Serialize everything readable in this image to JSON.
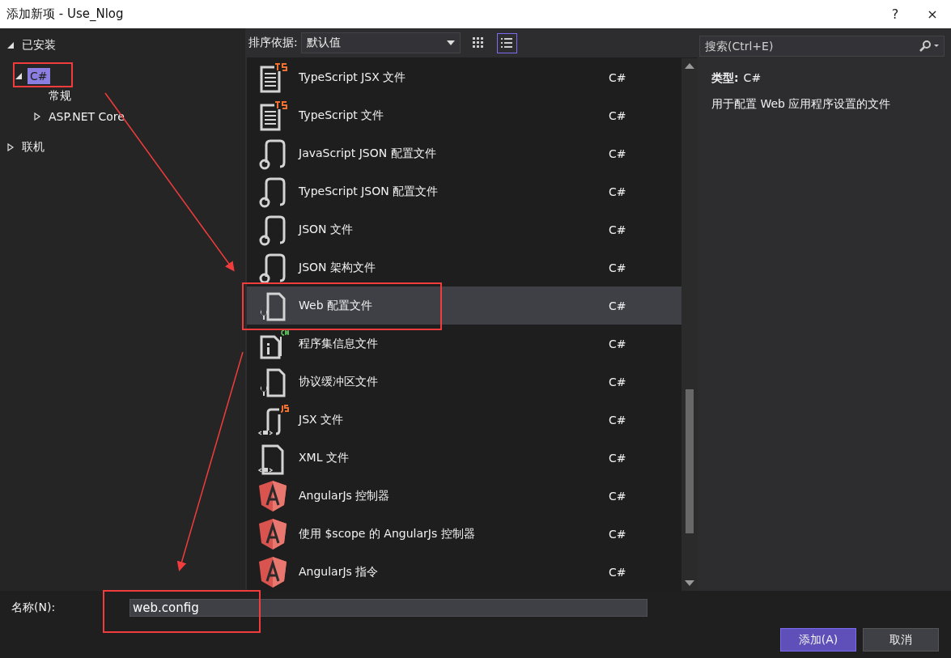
{
  "window": {
    "title": "添加新项 - Use_Nlog",
    "buttons": [
      "?",
      "×"
    ]
  },
  "tree": [
    {
      "label": "已安装",
      "expanded": true,
      "selected": false,
      "children": [
        {
          "label": "C#",
          "expanded": true,
          "selected": true,
          "children": [
            {
              "label": "常规",
              "selected": false
            },
            {
              "label": "ASP.NET Core",
              "expanded": false,
              "selected": false
            }
          ]
        }
      ]
    },
    {
      "label": "联机",
      "expanded": false,
      "selected": false
    }
  ],
  "toolbar": {
    "sort_label": "排序依据:",
    "sort_value": "默认值",
    "views": [
      {
        "kind": "grid",
        "selected": false
      },
      {
        "kind": "list",
        "selected": true
      }
    ]
  },
  "templates": [
    {
      "name": "TypeScript JSX 文件",
      "type": "C#",
      "kind": "ts",
      "selected": false
    },
    {
      "name": "TypeScript 文件",
      "type": "C#",
      "kind": "ts",
      "selected": false
    },
    {
      "name": "JavaScript JSON 配置文件",
      "type": "C#",
      "kind": "json",
      "selected": false
    },
    {
      "name": "TypeScript JSON 配置文件",
      "type": "C#",
      "kind": "json",
      "selected": false
    },
    {
      "name": "JSON 文件",
      "type": "C#",
      "kind": "json",
      "selected": false
    },
    {
      "name": "JSON 架构文件",
      "type": "C#",
      "kind": "json",
      "selected": false
    },
    {
      "name": "Web 配置文件",
      "type": "C#",
      "kind": "config",
      "selected": true
    },
    {
      "name": "程序集信息文件",
      "type": "C#",
      "kind": "info",
      "selected": false
    },
    {
      "name": "协议缓冲区文件",
      "type": "C#",
      "kind": "config",
      "selected": false
    },
    {
      "name": "JSX 文件",
      "type": "C#",
      "kind": "jsx",
      "selected": false
    },
    {
      "name": "XML 文件",
      "type": "C#",
      "kind": "xml",
      "selected": false
    },
    {
      "name": "AngularJs 控制器",
      "type": "C#",
      "kind": "angular",
      "selected": false
    },
    {
      "name": "使用 $scope 的 AngularJs 控制器",
      "type": "C#",
      "kind": "angular",
      "selected": false
    },
    {
      "name": "AngularJs 指令",
      "type": "C#",
      "kind": "angular",
      "selected": false
    }
  ],
  "details": {
    "search_placeholder": "搜索(Ctrl+E)",
    "type_label": "类型:",
    "type_value": "C#",
    "description": "用于配置 Web 应用程序设置的文件"
  },
  "name_field": {
    "label": "名称(N):",
    "value": "web.config"
  },
  "buttons": [
    {
      "label": "添加(A)",
      "kind": "primary"
    },
    {
      "label": "取消",
      "kind": "secondary"
    }
  ]
}
